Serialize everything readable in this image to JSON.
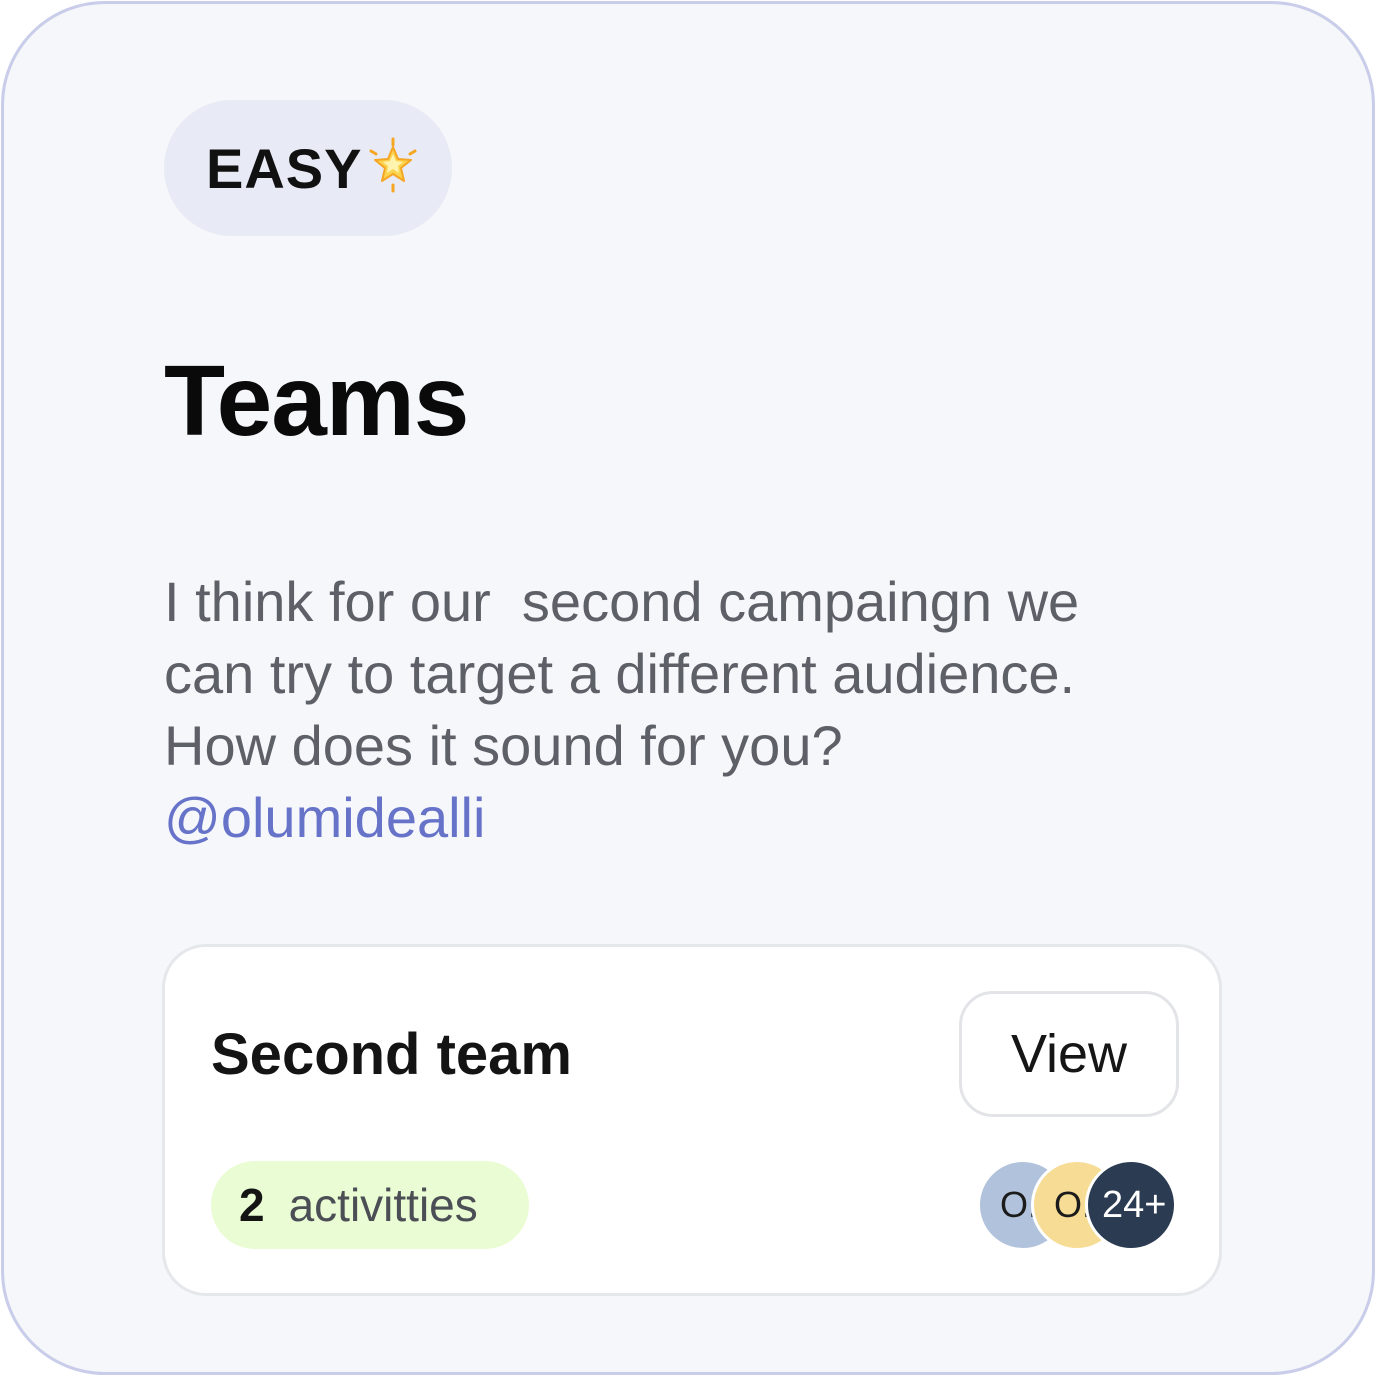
{
  "badge": {
    "label": "EASY",
    "icon": "glowing-star-icon",
    "background": "#e8eaf6"
  },
  "title": "Teams",
  "description": {
    "lines": [
      "I think for our  second campaingn we",
      "can try to target a different audience.",
      "How does it sound for you?"
    ],
    "mention": "@olumidealli",
    "mention_color": "#6673c8"
  },
  "team_card": {
    "name": "Second team",
    "view_button_label": "View",
    "activities": {
      "count": "2",
      "label": "activitties",
      "background": "#eafcd3"
    },
    "avatars": [
      {
        "initials": "O.",
        "color": "#b1c3dc"
      },
      {
        "initials": "O.",
        "color": "#f6dc94"
      }
    ],
    "more_members": "24+",
    "more_members_color": "#2b3b52"
  }
}
